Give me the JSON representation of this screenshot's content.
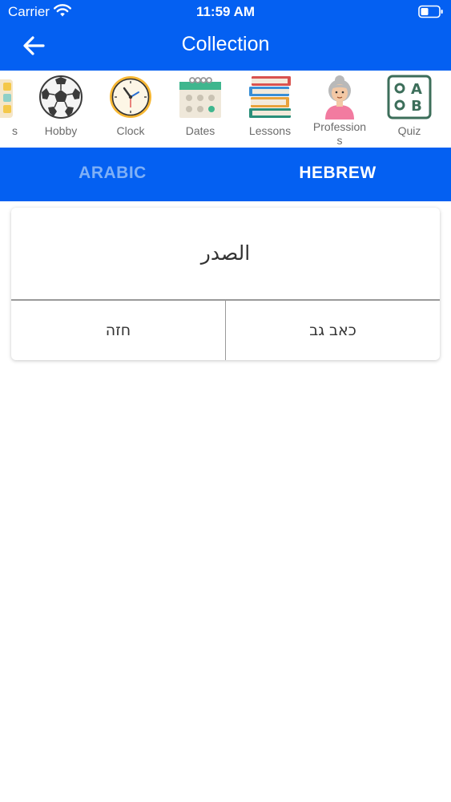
{
  "status": {
    "carrier": "Carrier",
    "time": "11:59 AM",
    "wifi_icon": "wifi-icon",
    "battery_icon": "battery-icon"
  },
  "nav": {
    "title": "Collection",
    "back_icon": "arrow-left-icon"
  },
  "categories": [
    {
      "label": "s",
      "icon": "colors-icon"
    },
    {
      "label": "Hobby",
      "icon": "soccer-ball-icon"
    },
    {
      "label": "Clock",
      "icon": "clock-icon"
    },
    {
      "label": "Dates",
      "icon": "calendar-icon"
    },
    {
      "label": "Lessons",
      "icon": "books-icon"
    },
    {
      "label": "Profession\ns",
      "icon": "person-icon"
    },
    {
      "label": "Quiz",
      "icon": "quiz-abc-icon"
    }
  ],
  "tabs": [
    {
      "label": "ARABIC",
      "selected": false
    },
    {
      "label": "HEBREW",
      "selected": true
    }
  ],
  "quiz": {
    "question": "الصدر",
    "answers": [
      "חזה",
      "כאב גב"
    ]
  },
  "colors": {
    "accent": "#0460f2",
    "tab_inactive": "#7fb0f6",
    "label_gray": "#6b6b6b"
  }
}
